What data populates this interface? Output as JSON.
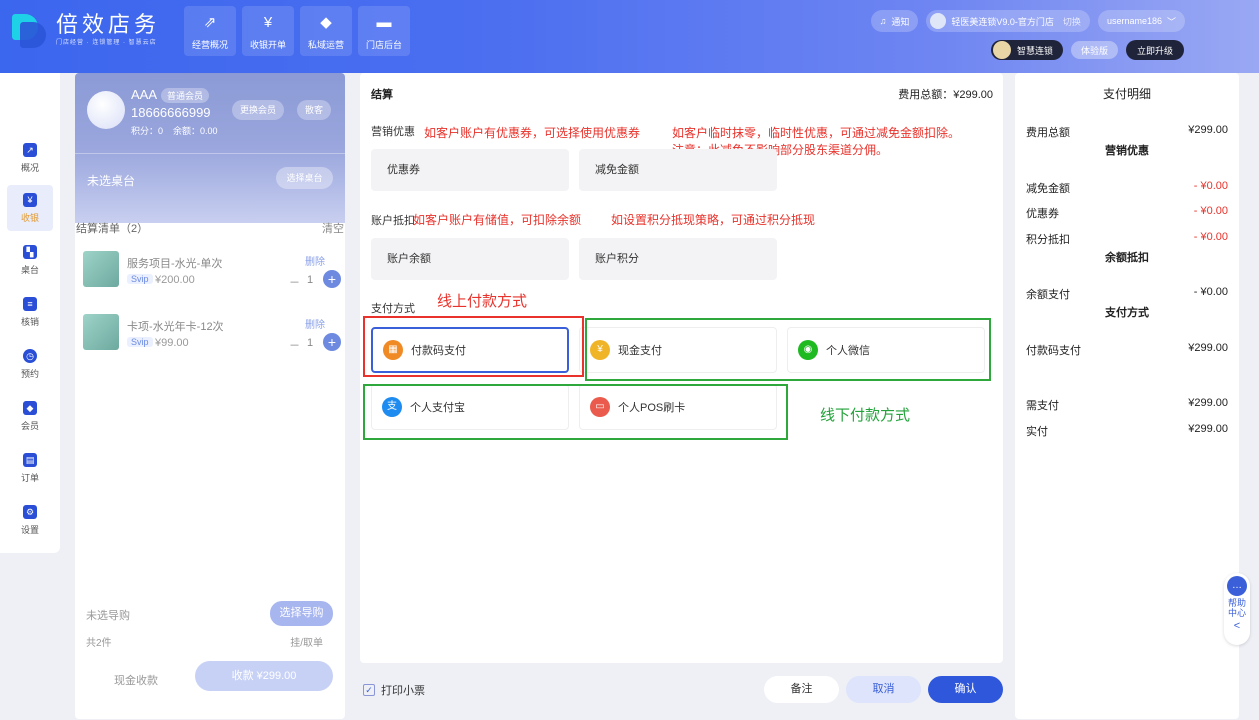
{
  "brand": {
    "title": "倍效店务",
    "subtitle": "门店经营 · 连锁管理 · 智慧云店"
  },
  "topnav": [
    {
      "label": "经营概况",
      "icon": "chart-icon"
    },
    {
      "label": "收银开单",
      "icon": "cashier-icon"
    },
    {
      "label": "私域运营",
      "icon": "community-icon"
    },
    {
      "label": "门店后台",
      "icon": "store-icon"
    }
  ],
  "header": {
    "notify": "通知",
    "store": "轻医美连锁V9.0-官方门店",
    "switch": "切换",
    "user": "username186",
    "chain": "智慧连锁",
    "trial": "体验版",
    "upgrade": "立即升级"
  },
  "leftnav": [
    {
      "label": "概况"
    },
    {
      "label": "收银",
      "active": true
    },
    {
      "label": "桌台"
    },
    {
      "label": "核销"
    },
    {
      "label": "预约"
    },
    {
      "label": "会员"
    },
    {
      "label": "订单"
    },
    {
      "label": "设置"
    }
  ],
  "member": {
    "name": "AAA",
    "level": "普通会员",
    "phone": "18666666999",
    "points_label": "积分：0",
    "balance_label": "余额：0.00",
    "change_btn": "更换会员",
    "guest_btn": "散客",
    "table_label": "未选桌台",
    "table_btn": "选择桌台"
  },
  "cart": {
    "title": "结算清单（2）",
    "clear": "清空",
    "items": [
      {
        "name": "服务项目-水光-单次",
        "svip": "Svip",
        "price": "¥200.00",
        "del": "删除",
        "minus": "－",
        "qty": "1",
        "plus": "+"
      },
      {
        "name": "卡项-水光年卡-12次",
        "svip": "Svip",
        "price": "¥99.00",
        "del": "删除",
        "minus": "－",
        "qty": "1",
        "plus": "+"
      }
    ]
  },
  "member_bottom": {
    "guide_label": "未选导购",
    "guide_btn": "选择导购",
    "count": "共2件",
    "hold": "挂/取单",
    "cash": "现金收款",
    "pay": "收款 ¥299.00"
  },
  "checkout": {
    "title": "结算",
    "total": "费用总额：¥299.00",
    "promo_label": "营销优惠",
    "promo_note1": "如客户账户有优惠券，可选择使用优惠券",
    "promo_note2": "如客户临时抹零，临时性优惠，可通过减免金额扣除。",
    "promo_note3": "注意：此减免不影响部分股东渠道分佣。",
    "coupon": "优惠券",
    "reduce": "减免金额",
    "account_label": "账户抵扣",
    "account_note1": "如客户账户有储值，可扣除余额",
    "account_note2": "如设置积分抵现策略，可通过积分抵现",
    "balance": "账户余额",
    "points": "账户积分",
    "pay_label": "支付方式",
    "online_note": "线上付款方式",
    "offline_note": "线下付款方式",
    "methods": [
      {
        "label": "付款码支付",
        "color": "#f08a24",
        "glyph": "▦"
      },
      {
        "label": "现金支付",
        "color": "#f0b429",
        "glyph": "¥"
      },
      {
        "label": "个人微信",
        "color": "#1fb922",
        "glyph": "◉"
      },
      {
        "label": "个人支付宝",
        "color": "#1e8bf0",
        "glyph": "支"
      },
      {
        "label": "个人POS刷卡",
        "color": "#ea5b4d",
        "glyph": "▭"
      }
    ]
  },
  "actions": {
    "print": "打印小票",
    "check": "✓",
    "note": "备注",
    "cancel": "取消",
    "ok": "确认"
  },
  "detail": {
    "title": "支付明细",
    "total_label": "费用总额",
    "total_value": "¥299.00",
    "g1": "营销优惠",
    "reduce_label": "减免金额",
    "reduce_value": "- ¥0.00",
    "coupon_label": "优惠券",
    "coupon_value": "- ¥0.00",
    "points_label": "积分抵扣",
    "points_value": "- ¥0.00",
    "g2": "余额抵扣",
    "balance_label": "余额支付",
    "balance_value": "- ¥0.00",
    "g3": "支付方式",
    "qr_label": "付款码支付",
    "qr_value": "¥299.00",
    "need_label": "需支付",
    "need_value": "¥299.00",
    "paid_label": "实付",
    "paid_value": "¥299.00"
  },
  "help": {
    "label1": "帮助",
    "label2": "中心",
    "arrow": "<"
  }
}
